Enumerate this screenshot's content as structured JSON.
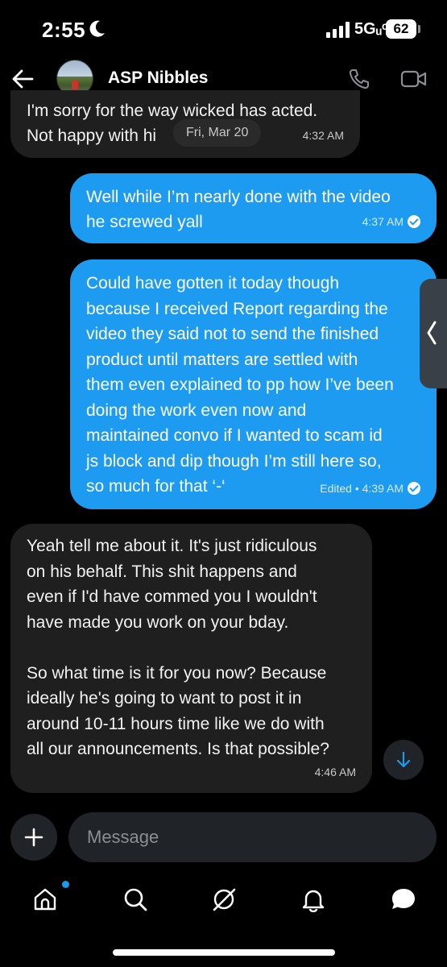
{
  "status_bar": {
    "time": "2:55",
    "network": "5Gᵤᶜ",
    "battery": "62"
  },
  "header": {
    "contact_name": "ASP Nibbles"
  },
  "chat": {
    "date_pill": "Fri, Mar 20",
    "messages": [
      {
        "direction": "incoming",
        "lines": [
          "I'm sorry for the way wicked has acted.",
          "Not happy with hi"
        ],
        "time": "4:32 AM"
      },
      {
        "direction": "outgoing",
        "lines": [
          "Well while I’m nearly done with the video",
          "he screwed yall"
        ],
        "time": "4:37 AM"
      },
      {
        "direction": "outgoing",
        "lines": [
          "Could have gotten it today though",
          "because I received Report regarding the",
          "video they said not to send the finished",
          "product until matters are settled with",
          "them even explained to pp how I’ve been",
          "doing the work even now and",
          "maintained convo if I wanted to scam id",
          "js block and dip though I’m still here so,",
          "so much for that ‘-‘"
        ],
        "time": "Edited • 4:39 AM"
      },
      {
        "direction": "incoming",
        "lines": [
          "Yeah tell me about it. It's just ridiculous",
          "on his behalf. This shit happens and",
          "even if I'd have commed you I wouldn't",
          "have made you work on your bday.",
          "",
          "So what time is it for you now? Because",
          "ideally he's going to want to post it in",
          "around 10-11 hours time like we do with",
          "all our announcements. Is that possible?"
        ],
        "time": "4:46 AM"
      }
    ]
  },
  "composer": {
    "placeholder": "Message"
  },
  "colors": {
    "accent": "#1d9bf0",
    "incoming_bubble": "#1f1f1f",
    "background": "#000000"
  }
}
